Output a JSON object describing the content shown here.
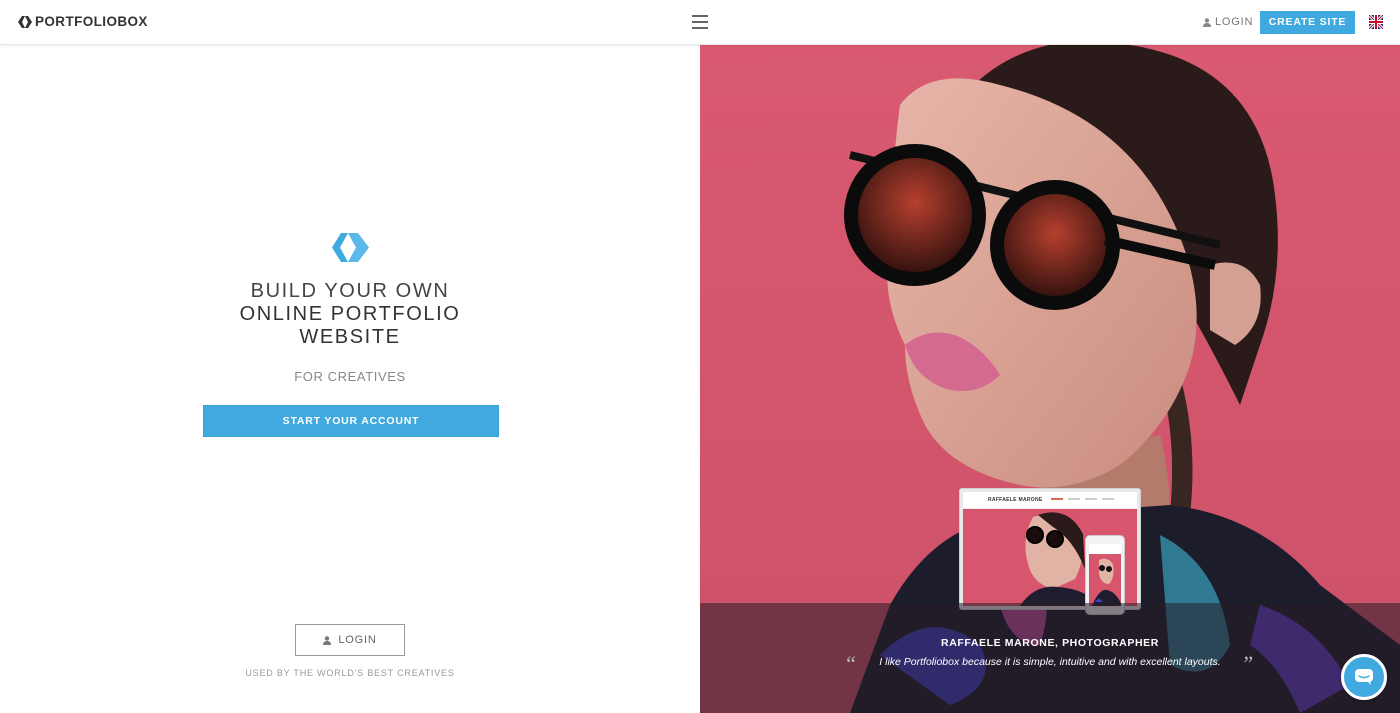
{
  "header": {
    "brand": "PORTFOLIOBOX",
    "login_label": "LOGIN",
    "create_site_label": "CREATE SITE",
    "language": "English (UK flag)"
  },
  "left": {
    "headline_line1": "BUILD YOUR OWN",
    "headline_line2": "ONLINE PORTFOLIO",
    "headline_line3": "WEBSITE",
    "subheadline": "FOR CREATIVES",
    "cta_label": "START YOUR ACCOUNT",
    "login_label": "LOGIN",
    "footer_text": "USED BY THE WORLD'S BEST CREATIVES"
  },
  "hero": {
    "mockup_brand": "RAFFAELE MARONE",
    "quote_author": "RAFFAELE MARONE, PHOTOGRAPHER",
    "quote_text": "I like Portfoliobox because it is simple, intuitive and with excellent layouts.",
    "open_quote": "“",
    "close_quote": "”"
  },
  "colors": {
    "accent": "#3fa9e0",
    "hero_bg": "#d8566d"
  },
  "icons": {
    "brand": "portfoliobox-logo-icon",
    "menu": "hamburger-menu-icon",
    "user": "user-icon",
    "flag": "uk-flag-icon",
    "chat": "chat-bubble-icon"
  }
}
